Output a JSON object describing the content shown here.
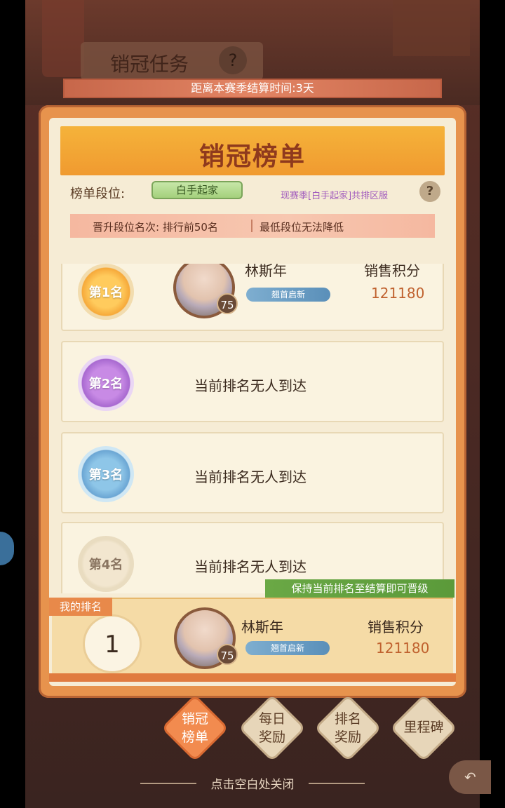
{
  "background": {
    "quest_title": "销冠任务",
    "quest_help_glyph": "?"
  },
  "timer": {
    "text": "距离本赛季结算时间:3天"
  },
  "panel": {
    "title": "销冠榜单",
    "tier_label": "榜单段位:",
    "tier_value": "白手起家",
    "tier_server": "现赛季[白手起家]共排区服",
    "tier_help_glyph": "?",
    "promo_left": "晋升段位名次: 排行前50名",
    "promo_right": "最低段位无法降低"
  },
  "ranks": [
    {
      "medal": "第1名",
      "name": "林斯年",
      "level": "75",
      "title": "翘首启新",
      "score_label": "销售积分",
      "score": "121180"
    },
    {
      "medal": "第2名",
      "empty": "当前排名无人到达"
    },
    {
      "medal": "第3名",
      "empty": "当前排名无人到达"
    },
    {
      "medal": "第4名",
      "empty": "当前排名无人到达"
    }
  ],
  "keep_banner": "保持当前排名至结算即可晋级",
  "my_rank": {
    "tag": "我的排名",
    "rank": "1",
    "name": "林斯年",
    "level": "75",
    "title": "翘首启新",
    "score_label": "销售积分",
    "score": "121180"
  },
  "tabs": [
    {
      "label": "销冠榜单",
      "active": true
    },
    {
      "label": "每日奖励",
      "active": false
    },
    {
      "label": "排名奖励",
      "active": false
    },
    {
      "label": "里程碑",
      "active": false
    }
  ],
  "close_hint": "点击空白处关闭",
  "colors": {
    "accent_orange": "#f28b4f",
    "ribbon": "#f5b33a",
    "score": "#c0622f",
    "keep_banner": "#6aa845"
  }
}
